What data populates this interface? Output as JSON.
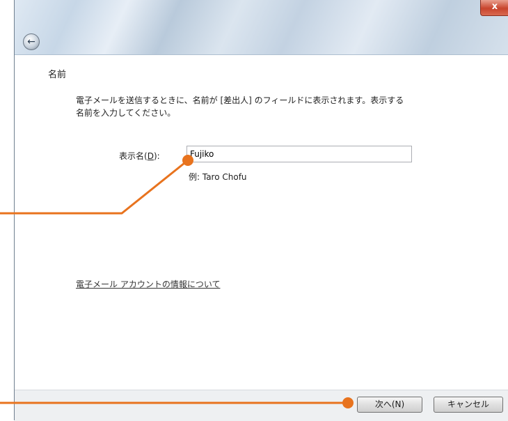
{
  "window": {
    "close_label": "x"
  },
  "back_icon": "arrow-left-icon",
  "page": {
    "title": "名前",
    "description_line1": "電子メールを送信するときに、名前が [差出人] のフィールドに表示されます。表示する",
    "description_line2": "名前を入力してください。",
    "field_label_prefix": "表示名(",
    "field_label_key": "D",
    "field_label_suffix": "):",
    "display_name_value": "Fujiko",
    "example": "例: Taro Chofu",
    "info_link": "電子メール アカウントの情報について"
  },
  "footer": {
    "next_label": "次へ(N)",
    "cancel_label": "キャンセル"
  },
  "colors": {
    "callout": "#e8731e"
  }
}
